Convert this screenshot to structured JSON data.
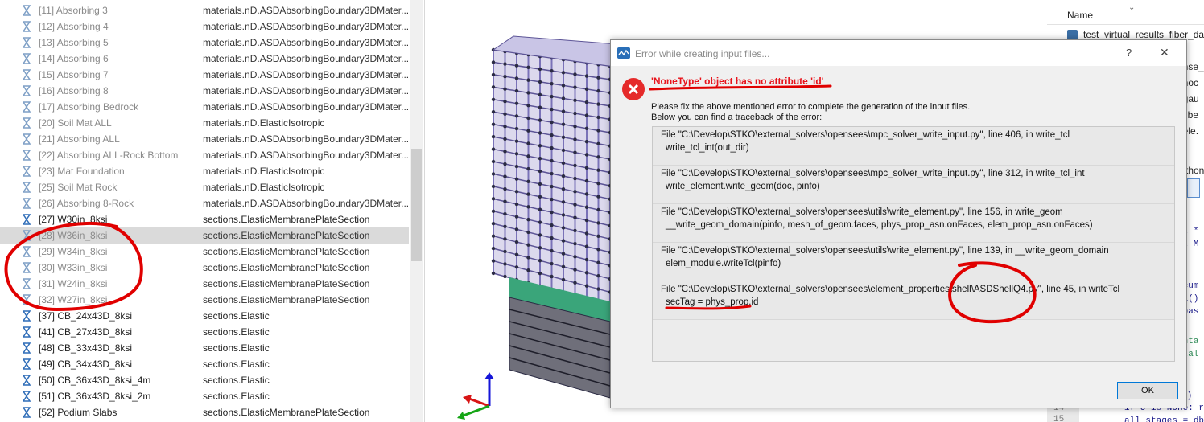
{
  "properties": [
    {
      "label": "[11] Absorbing 3",
      "type": "materials.nD.ASDAbsorbingBoundary3DMater...",
      "dim": true
    },
    {
      "label": "[12] Absorbing 4",
      "type": "materials.nD.ASDAbsorbingBoundary3DMater...",
      "dim": true
    },
    {
      "label": "[13] Absorbing 5",
      "type": "materials.nD.ASDAbsorbingBoundary3DMater...",
      "dim": true
    },
    {
      "label": "[14] Absorbing 6",
      "type": "materials.nD.ASDAbsorbingBoundary3DMater...",
      "dim": true
    },
    {
      "label": "[15] Absorbing 7",
      "type": "materials.nD.ASDAbsorbingBoundary3DMater...",
      "dim": true
    },
    {
      "label": "[16] Absorbing 8",
      "type": "materials.nD.ASDAbsorbingBoundary3DMater...",
      "dim": true
    },
    {
      "label": "[17] Absorbing Bedrock",
      "type": "materials.nD.ASDAbsorbingBoundary3DMater...",
      "dim": true
    },
    {
      "label": "[20] Soil Mat ALL",
      "type": "materials.nD.ElasticIsotropic",
      "dim": true
    },
    {
      "label": "[21] Absorbing ALL",
      "type": "materials.nD.ASDAbsorbingBoundary3DMater...",
      "dim": true
    },
    {
      "label": "[22] Absorbing ALL-Rock Bottom",
      "type": "materials.nD.ASDAbsorbingBoundary3DMater...",
      "dim": true
    },
    {
      "label": "[23] Mat Foundation",
      "type": "materials.nD.ElasticIsotropic",
      "dim": true
    },
    {
      "label": "[25] Soil Mat Rock",
      "type": "materials.nD.ElasticIsotropic",
      "dim": true
    },
    {
      "label": "[26] Absorbing 8-Rock",
      "type": "materials.nD.ASDAbsorbingBoundary3DMater...",
      "dim": true
    },
    {
      "label": "[27] W30in_8ksi",
      "type": "sections.ElasticMembranePlateSection",
      "dim": false
    },
    {
      "label": "[28] W36in_8ksi",
      "type": "sections.ElasticMembranePlateSection",
      "dim": true,
      "selected": true
    },
    {
      "label": "[29] W34in_8ksi",
      "type": "sections.ElasticMembranePlateSection",
      "dim": true
    },
    {
      "label": "[30] W33in_8ksi",
      "type": "sections.ElasticMembranePlateSection",
      "dim": true
    },
    {
      "label": "[31] W24in_8ksi",
      "type": "sections.ElasticMembranePlateSection",
      "dim": true
    },
    {
      "label": "[32] W27in_8ksi",
      "type": "sections.ElasticMembranePlateSection",
      "dim": true
    },
    {
      "label": "[37] CB_24x43D_8ksi",
      "type": "sections.Elastic",
      "dim": false
    },
    {
      "label": "[41] CB_27x43D_8ksi",
      "type": "sections.Elastic",
      "dim": false
    },
    {
      "label": "[48] CB_33x43D_8ksi",
      "type": "sections.Elastic",
      "dim": false
    },
    {
      "label": "[49] CB_34x43D_8ksi",
      "type": "sections.Elastic",
      "dim": false
    },
    {
      "label": "[50] CB_36x43D_8ksi_4m",
      "type": "sections.Elastic",
      "dim": false
    },
    {
      "label": "[51] CB_36x43D_8ksi_2m",
      "type": "sections.Elastic",
      "dim": false
    },
    {
      "label": "[52] Podium Slabs",
      "type": "sections.ElasticMembranePlateSection",
      "dim": false
    }
  ],
  "right_panel": {
    "header": "Name",
    "file": "test_virtual_results_fiber_dam",
    "fragments": [
      "ense_s",
      "_noc",
      "_gau",
      "_fibe",
      "_ele."
    ],
    "thon": "thon",
    "code_lines": [
      "rt *",
      "rt M",
      "ocum",
      "al()",
      "abas",
      "enta",
      "ntal",
      ", U)",
      "if U is None: r",
      "all_stages = db"
    ],
    "line_numbers": [
      "14",
      "15"
    ]
  },
  "dialog": {
    "title": "Error while creating input files...",
    "help": "?",
    "close": "✕",
    "error_message": "'NoneType' object has no attribute 'id'",
    "instruction_1": "Please fix the above mentioned error to complete the generation of the input files.",
    "instruction_2": "Below you can find a traceback of the error:",
    "traceback": [
      {
        "file": "File \"C:\\Develop\\STKO\\external_solvers\\opensees\\mpc_solver_write_input.py\", line 406, in write_tcl",
        "code": "write_tcl_int(out_dir)"
      },
      {
        "file": "File \"C:\\Develop\\STKO\\external_solvers\\opensees\\mpc_solver_write_input.py\", line 312, in write_tcl_int",
        "code": "write_element.write_geom(doc, pinfo)"
      },
      {
        "file": "File \"C:\\Develop\\STKO\\external_solvers\\opensees\\utils\\write_element.py\", line 156, in write_geom",
        "code": "__write_geom_domain(pinfo, mesh_of_geom.faces,  phys_prop_asn.onFaces, elem_prop_asn.onFaces)"
      },
      {
        "file": "File \"C:\\Develop\\STKO\\external_solvers\\opensees\\utils\\write_element.py\", line 139, in __write_geom_domain",
        "code": "elem_module.writeTcl(pinfo)"
      },
      {
        "file": "File \"C:\\Develop\\STKO\\external_solvers\\opensees\\element_properties\\shell\\ASDShellQ4.py\", line 45, in writeTcl",
        "code": "secTag = phys_prop.id"
      }
    ],
    "ok_label": "OK"
  },
  "colors": {
    "error_red": "#e8131b",
    "annotation_red": "#e00000",
    "mesh_purple": "#8e86c4",
    "mesh_dark": "#2b2b44",
    "slab_green": "#3aa57a",
    "icon_blue": "#3a6ea5"
  }
}
